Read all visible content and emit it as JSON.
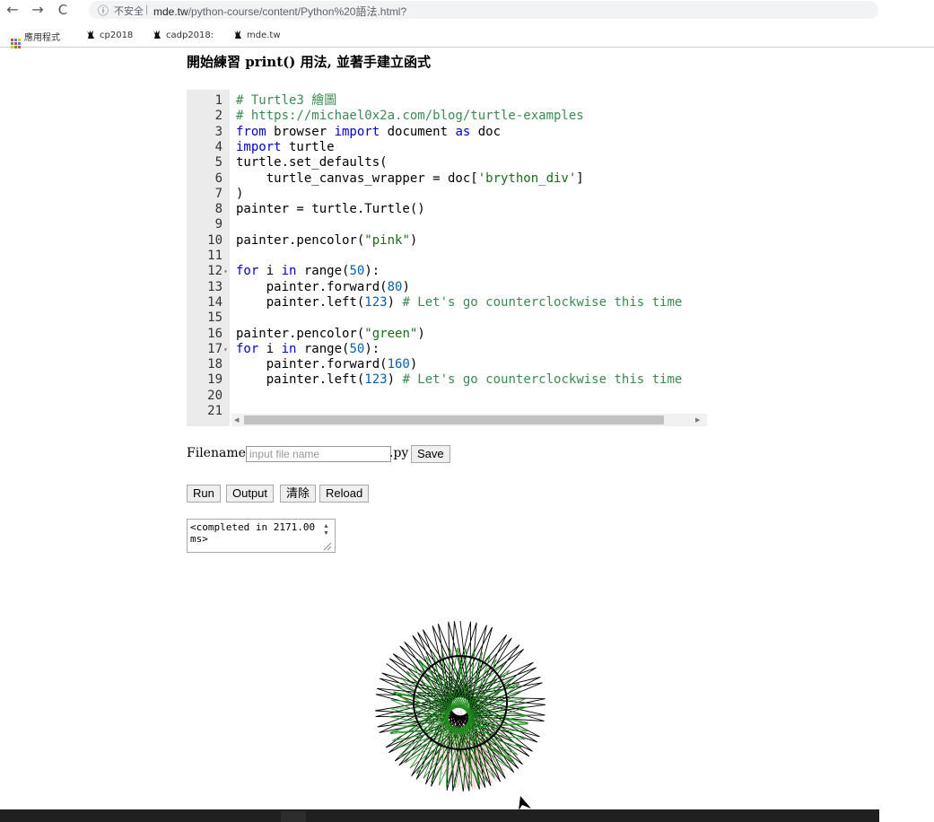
{
  "browser": {
    "nav": {
      "back_icon": "←",
      "forward_icon": "→",
      "reload_icon": "C",
      "info_icon": "ⓘ"
    },
    "insecure_label": "不安全",
    "url_host": "mde.tw",
    "url_path": "/python-course/content/Python%20語法.html?",
    "bookmarks": [
      "應用程式",
      "cp2018",
      "cadp2018:",
      "mde.tw"
    ]
  },
  "page": {
    "title": "開始練習 print() 用法, 並著手建立函式"
  },
  "editor": {
    "lines": [
      {
        "n": "1",
        "segs": [
          {
            "c": "cm",
            "t": "# Turtle3 繪圖"
          }
        ]
      },
      {
        "n": "2",
        "segs": [
          {
            "c": "cm",
            "t": "# https://michael0x2a.com/blog/turtle-examples"
          }
        ]
      },
      {
        "n": "3",
        "segs": [
          {
            "c": "kw",
            "t": "from"
          },
          {
            "c": "",
            "t": " browser "
          },
          {
            "c": "kw",
            "t": "import"
          },
          {
            "c": "",
            "t": " document "
          },
          {
            "c": "kw",
            "t": "as"
          },
          {
            "c": "",
            "t": " doc"
          }
        ]
      },
      {
        "n": "4",
        "segs": [
          {
            "c": "kw",
            "t": "import"
          },
          {
            "c": "",
            "t": " turtle"
          }
        ]
      },
      {
        "n": "5",
        "segs": [
          {
            "c": "",
            "t": "turtle.set_defaults("
          }
        ]
      },
      {
        "n": "6",
        "segs": [
          {
            "c": "",
            "t": "    turtle_canvas_wrapper = doc["
          },
          {
            "c": "st",
            "t": "'brython_div'"
          },
          {
            "c": "",
            "t": "]"
          }
        ]
      },
      {
        "n": "7",
        "segs": [
          {
            "c": "",
            "t": ")"
          }
        ]
      },
      {
        "n": "8",
        "segs": [
          {
            "c": "",
            "t": "painter = turtle.Turtle()"
          }
        ]
      },
      {
        "n": "9",
        "segs": []
      },
      {
        "n": "10",
        "segs": [
          {
            "c": "",
            "t": "painter.pencolor("
          },
          {
            "c": "st",
            "t": "\"pink\""
          },
          {
            "c": "",
            "t": ")"
          }
        ]
      },
      {
        "n": "11",
        "segs": []
      },
      {
        "n": "12",
        "fold": true,
        "segs": [
          {
            "c": "kw",
            "t": "for"
          },
          {
            "c": "",
            "t": " i "
          },
          {
            "c": "kw",
            "t": "in"
          },
          {
            "c": "",
            "t": " range("
          },
          {
            "c": "nm",
            "t": "50"
          },
          {
            "c": "",
            "t": "):"
          }
        ]
      },
      {
        "n": "13",
        "segs": [
          {
            "c": "",
            "t": "    painter.forward("
          },
          {
            "c": "nm",
            "t": "80"
          },
          {
            "c": "",
            "t": ")"
          }
        ]
      },
      {
        "n": "14",
        "segs": [
          {
            "c": "",
            "t": "    painter.left("
          },
          {
            "c": "nm",
            "t": "123"
          },
          {
            "c": "",
            "t": ") "
          },
          {
            "c": "cm",
            "t": "# Let's go counterclockwise this time"
          }
        ]
      },
      {
        "n": "15",
        "segs": []
      },
      {
        "n": "16",
        "segs": [
          {
            "c": "",
            "t": "painter.pencolor("
          },
          {
            "c": "st",
            "t": "\"green\""
          },
          {
            "c": "",
            "t": ")"
          }
        ]
      },
      {
        "n": "17",
        "fold": true,
        "segs": [
          {
            "c": "kw",
            "t": "for"
          },
          {
            "c": "",
            "t": " i "
          },
          {
            "c": "kw",
            "t": "in"
          },
          {
            "c": "",
            "t": " range("
          },
          {
            "c": "nm",
            "t": "50"
          },
          {
            "c": "",
            "t": "):"
          }
        ]
      },
      {
        "n": "18",
        "segs": [
          {
            "c": "",
            "t": "    painter.forward("
          },
          {
            "c": "nm",
            "t": "160"
          },
          {
            "c": "",
            "t": ")"
          }
        ]
      },
      {
        "n": "19",
        "segs": [
          {
            "c": "",
            "t": "    painter.left("
          },
          {
            "c": "nm",
            "t": "123"
          },
          {
            "c": "",
            "t": ") "
          },
          {
            "c": "cm",
            "t": "# Let's go counterclockwise this time"
          }
        ]
      },
      {
        "n": "20",
        "segs": []
      },
      {
        "n": "21",
        "segs": []
      }
    ]
  },
  "file": {
    "label": "Filename:",
    "placeholder": "input file name",
    "extension": ".py",
    "save_label": "Save"
  },
  "controls": {
    "run_label": "Run",
    "output_label": "Output",
    "clear_label": "清除",
    "reload_label": "Reload"
  },
  "output": {
    "text": "<completed in 2171.00 ms>"
  },
  "drawing": {
    "colors": {
      "pink": "#f5b8c4",
      "green": "#1c8a1c",
      "black": "#000000"
    }
  }
}
